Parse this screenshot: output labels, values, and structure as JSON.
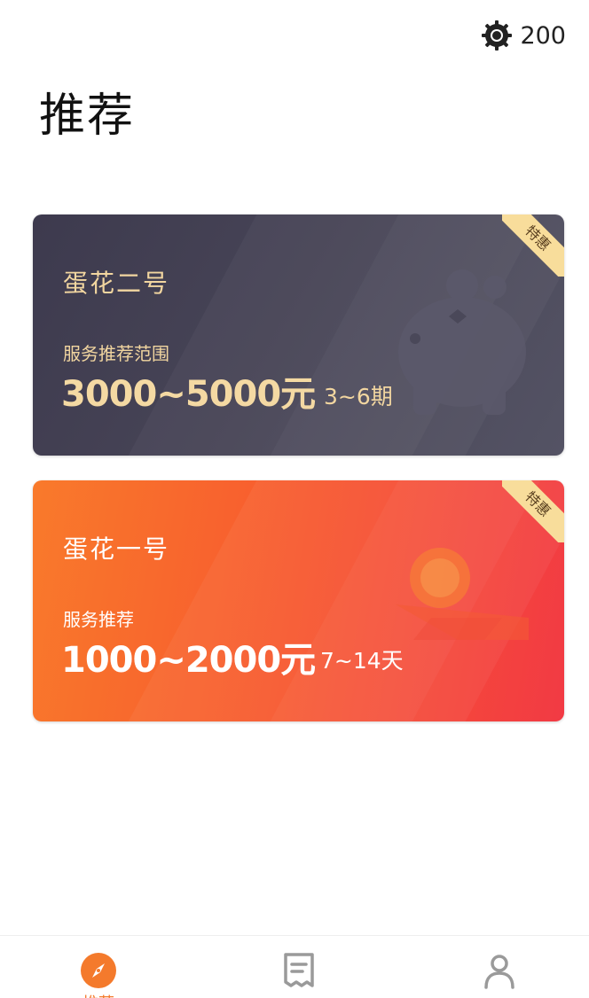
{
  "header": {
    "coin_icon": "gear-coin-icon",
    "coin_count": "200",
    "title": "推荐"
  },
  "cards": [
    {
      "name": "蛋花二号",
      "subtitle": "服务推荐范围",
      "amount": "3000~5000元",
      "term": "3~6期",
      "badge": "特惠",
      "art_icon": "piggy-bank-icon",
      "colors": {
        "start": "#3d3a4e",
        "end": "#545364",
        "text": "#f2d6a0"
      }
    },
    {
      "name": "蛋花一号",
      "subtitle": "服务推荐",
      "amount": "1000~2000元",
      "term": "7~14天",
      "badge": "特惠",
      "art_icon": "coin-stack-icon",
      "colors": {
        "start": "#f97a2b",
        "end": "#f23a44",
        "text": "#ffffff"
      }
    }
  ],
  "bottom_nav": {
    "items": [
      {
        "label": "推荐",
        "icon": "compass-icon",
        "active": true
      },
      {
        "label": "",
        "icon": "receipt-icon",
        "active": false
      },
      {
        "label": "",
        "icon": "user-icon",
        "active": false
      }
    ],
    "active_color": "#f47a2c",
    "inactive_color": "#9a9a9a"
  }
}
